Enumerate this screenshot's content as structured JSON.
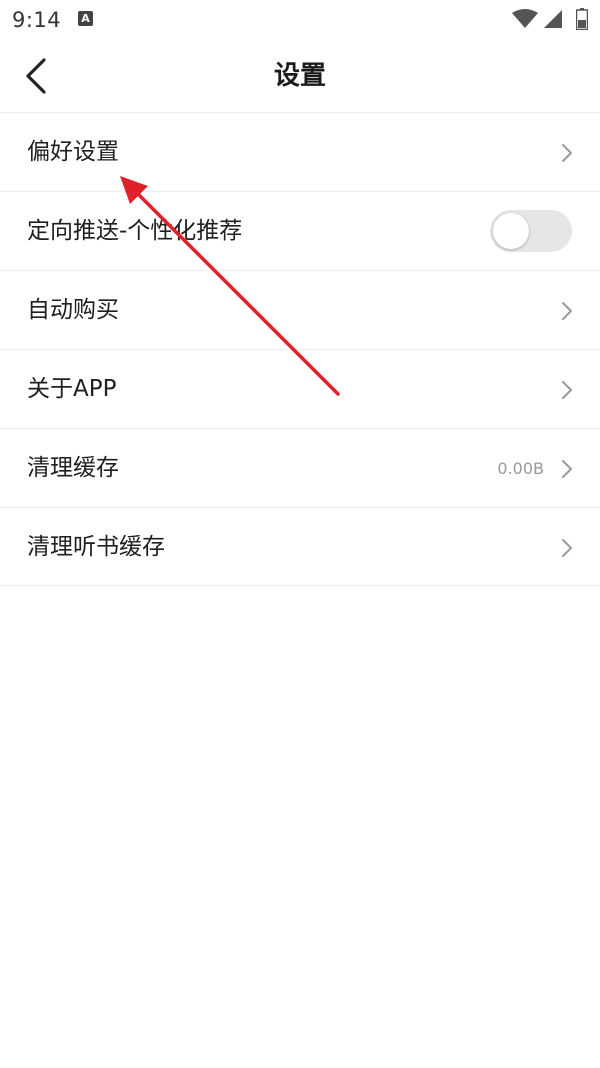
{
  "status_bar": {
    "time": "9:14",
    "app_icon_letter": "A"
  },
  "header": {
    "title": "设置"
  },
  "settings": [
    {
      "label": "偏好设置"
    },
    {
      "label": "定向推送-个性化推荐",
      "toggle_on": false
    },
    {
      "label": "自动购买"
    },
    {
      "label": "关于APP"
    },
    {
      "label": "清理缓存",
      "value": "0.00B"
    },
    {
      "label": "清理听书缓存"
    }
  ],
  "colors": {
    "annotation_arrow": "#e0202a",
    "toggle_off_track": "#e6e6e6"
  }
}
